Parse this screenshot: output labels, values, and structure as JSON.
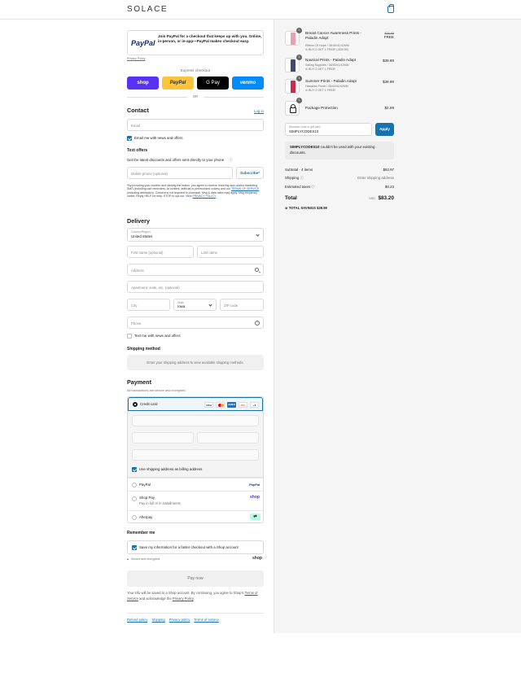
{
  "header": {
    "logo": "SOLACE"
  },
  "paypal_banner": {
    "logo": "PayPal",
    "text": "Join PayPal for a checkout that keeps up with you. Online, in-person, or in-app—PayPal makes checkout easy.",
    "policy": "Privacy Policy"
  },
  "express": {
    "title": "Express checkout",
    "buttons": [
      "shop",
      "PayPal",
      "G Pay",
      "venmo"
    ],
    "or": "OR"
  },
  "contact": {
    "title": "Contact",
    "login": "Log in",
    "email_placeholder": "Email",
    "email_news": "Email me with news and offers"
  },
  "text_offers": {
    "title": "Text offers",
    "subtitle": "Get the latest discounts and offers sent directly to your phone",
    "phone_placeholder": "Mobile phone (optional)",
    "subscribe": "Subscribe*",
    "disclaimer_a": "*By providing your number and clicking the button, you agree to receive recurring auto-dialed marketing SMS (including cart reminders, AI content, artificial or prerecorded voices) and our ",
    "disclaimer_tos": "TERMS OF SERVICE",
    "disclaimer_b": " (including arbitration). Consent is not required to purchase. Msg & data rates may apply. Msg frequency varies. Reply HELP for help; STOP to opt-out. View ",
    "disclaimer_pp": "PRIVACY POLICY",
    "disclaimer_c": "."
  },
  "delivery": {
    "title": "Delivery",
    "country_label": "Country/Region",
    "country": "United States",
    "first_name": "First name (optional)",
    "last_name": "Last name",
    "address": "Address",
    "apartment": "Apartment, suite, etc. (optional)",
    "city": "City",
    "state_label": "State",
    "state": "Iowa",
    "zip": "ZIP code",
    "phone": "Phone",
    "text_news": "Text me with news and offers"
  },
  "shipping_method": {
    "title": "Shipping method",
    "message": "Enter your shipping address to view available shipping methods."
  },
  "payment": {
    "title": "Payment",
    "subtitle": "All transactions are secure and encrypted.",
    "credit_card": "Credit card",
    "card_brands": [
      "VISA",
      "MC",
      "AMEX",
      "DISC",
      "+4"
    ],
    "billing_same": "Use shipping address as billing address",
    "paypal": "PayPal",
    "paypal_logo": "PayPal",
    "shop_pay": "Shop Pay",
    "shop_pay_sub": "Pay in full or in installments",
    "shop_logo": "shop",
    "afterpay": "Afterpay"
  },
  "remember": {
    "title": "Remember me",
    "save_info": "Save my information for a faster checkout with a Shop account",
    "secure": "Secure and encrypted",
    "shop_logo": "shop"
  },
  "pay_now": "Pay now",
  "legal": {
    "text_a": "Your info will be saved to a Shop account. By continuing, you agree to Shop’s ",
    "tos": "Terms of Service",
    "text_b": " and acknowledge the ",
    "pp": "Privacy Policy",
    "text_c": "."
  },
  "footer": [
    "Refund policy",
    "Shipping",
    "Privacy policy",
    "Terms of service"
  ],
  "order": {
    "items": [
      {
        "qty": "1",
        "name": "Breast Cancer Awareness Prints - Paladin Adapt",
        "meta": "Ribbon Of Hope / 38/40/41/42MM",
        "promo": "BUY 2 GET 1 FREE! (-$39.99)",
        "original": "$39.99",
        "price": "FREE"
      },
      {
        "qty": "1",
        "name": "Nautical Prints - Paladin Adapt",
        "meta": "Sailing Supplies / 38/40/41/42MM",
        "promo": "BUY 2 GET 1 FREE!",
        "original": "",
        "price": "$39.99"
      },
      {
        "qty": "1",
        "name": "Summer Prints - Paladin Adapt",
        "meta": "Hawaiian Floral / 38/40/41/42MM",
        "promo": "BUY 2 GET 1 FREE!",
        "original": "",
        "price": "$39.99"
      },
      {
        "qty": "1",
        "name": "Package Protection",
        "meta": "",
        "promo": "",
        "original": "",
        "price": "$2.99"
      }
    ],
    "discount_label": "Discount code or gift card",
    "discount_value": "SIMPLYCODES10",
    "apply": "Apply",
    "discount_code": "SIMPLYCODES10",
    "discount_error": " couldn't be used with your existing discounts.",
    "subtotal_label": "Subtotal · 4 items",
    "subtotal": "$82.97",
    "shipping_label": "Shipping",
    "shipping": "Enter shipping address",
    "taxes_label": "Estimated taxes",
    "taxes": "$0.23",
    "total_label": "Total",
    "currency": "USD",
    "total": "$83.20",
    "savings_label": "TOTAL SAVINGS",
    "savings": "$39.99"
  },
  "colors": {
    "accent": "#1773b0",
    "shop": "#5a31f4",
    "paypal_yellow": "#ffc439",
    "venmo": "#008cff"
  }
}
